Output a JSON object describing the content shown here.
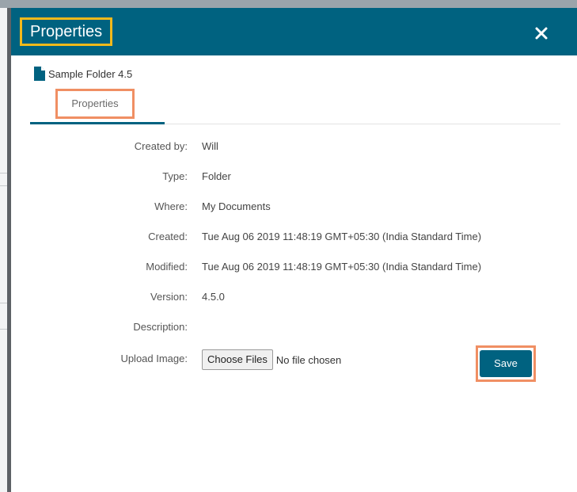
{
  "dialog": {
    "title": "Properties",
    "close_icon": "close-icon"
  },
  "item": {
    "icon": "file-icon",
    "name": "Sample Folder 4.5"
  },
  "tabs": [
    {
      "label": "Properties",
      "active": true
    }
  ],
  "properties": [
    {
      "label": "Created by:",
      "value": "Will"
    },
    {
      "label": "Type:",
      "value": "Folder"
    },
    {
      "label": "Where:",
      "value": "My Documents"
    },
    {
      "label": "Created:",
      "value": "Tue Aug 06 2019 11:48:19 GMT+05:30 (India Standard Time)"
    },
    {
      "label": "Modified:",
      "value": "Tue Aug 06 2019 11:48:19 GMT+05:30 (India Standard Time)"
    },
    {
      "label": "Version:",
      "value": "4.5.0"
    },
    {
      "label": "Description:",
      "value": ""
    }
  ],
  "upload": {
    "label": "Upload Image:",
    "button_label": "Choose Files",
    "status": "No file chosen"
  },
  "actions": {
    "save_label": "Save"
  },
  "colors": {
    "header": "#006280",
    "title_highlight": "#f2b91b",
    "annotation_highlight": "#f08f63",
    "save_button": "#006280"
  }
}
